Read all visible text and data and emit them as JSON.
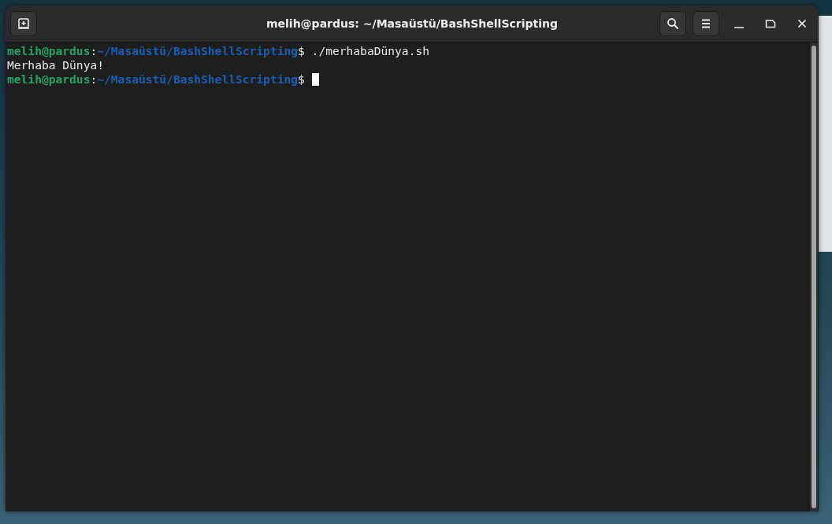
{
  "window": {
    "title": "melih@pardus: ~/Masaüstü/BashShellScripting"
  },
  "terminal": {
    "lines": [
      {
        "segments": [
          {
            "kind": "user",
            "text": "melih@pardus"
          },
          {
            "kind": "plain",
            "text": ":"
          },
          {
            "kind": "path",
            "text": "~/Masaüstü/BashShellScripting"
          },
          {
            "kind": "plain",
            "text": "$ ./merhabaDünya.sh"
          }
        ],
        "cursor": false
      },
      {
        "segments": [
          {
            "kind": "plain",
            "text": "Merhaba Dünya!"
          }
        ],
        "cursor": false
      },
      {
        "segments": [
          {
            "kind": "user",
            "text": "melih@pardus"
          },
          {
            "kind": "plain",
            "text": ":"
          },
          {
            "kind": "path",
            "text": "~/Masaüstü/BashShellScripting"
          },
          {
            "kind": "plain",
            "text": "$"
          }
        ],
        "cursor": true
      }
    ]
  }
}
